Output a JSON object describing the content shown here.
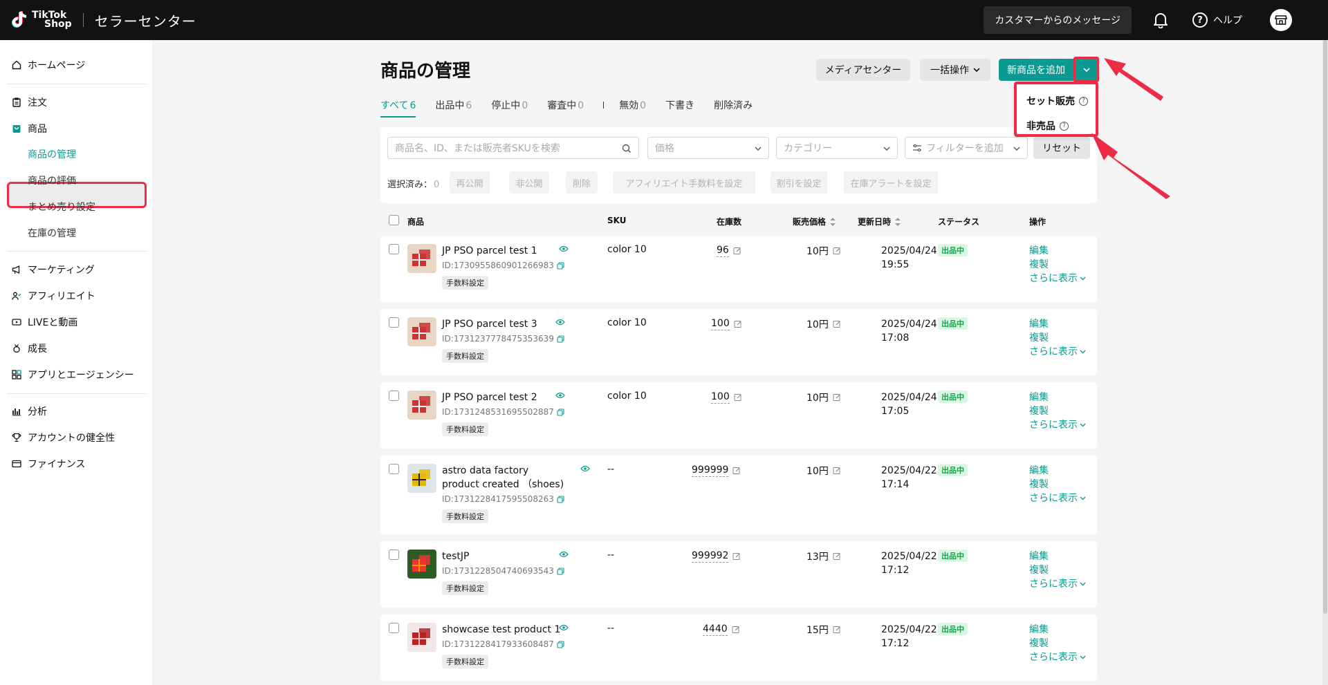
{
  "app": {
    "logo_text_1": "TikTok",
    "logo_text_2": "Shop",
    "title": "セラーセンター",
    "customer_messages": "カスタマーからのメッセージ",
    "help": "ヘルプ"
  },
  "sidebar": {
    "home": "ホームページ",
    "orders": "注文",
    "products": "商品",
    "products_sub": [
      "商品の管理",
      "商品の評価",
      "まとめ売り設定",
      "在庫の管理"
    ],
    "marketing": "マーケティング",
    "affiliate": "アフィリエイト",
    "live": "LIVEと動画",
    "growth": "成長",
    "apps": "アプリとエージェンシー",
    "analytics": "分析",
    "account_health": "アカウントの健全性",
    "finance": "ファイナンス"
  },
  "header": {
    "title": "商品の管理",
    "media_center": "メディアセンター",
    "bulk_ops": "一括操作",
    "add_product": "新商品を追加"
  },
  "add_menu": {
    "items": [
      "セット販売",
      "非売品"
    ]
  },
  "tabs": [
    {
      "label": "すべて",
      "count": "6"
    },
    {
      "label": "出品中",
      "count": "6"
    },
    {
      "label": "停止中",
      "count": "0"
    },
    {
      "label": "審査中",
      "count": "0"
    },
    {
      "label": "無効",
      "count": "0"
    },
    {
      "label": "下書き",
      "count": ""
    },
    {
      "label": "削除済み",
      "count": ""
    }
  ],
  "filters": {
    "search_placeholder": "商品名、ID、または販売者SKUを検索",
    "price": "価格",
    "category": "カテゴリー",
    "add_filter": "フィルターを追加",
    "reset": "リセット",
    "selected_label": "選択済み：",
    "selected_count": "0",
    "bulk_actions": [
      "再公開",
      "非公開",
      "削除",
      "アフィリエイト手数料を設定",
      "割引を設定",
      "在庫アラートを設定"
    ]
  },
  "table": {
    "columns": [
      "商品",
      "SKU",
      "在庫数",
      "販売価格",
      "更新日時",
      "ステータス",
      "操作"
    ],
    "fee_tag": "手数料設定",
    "ops": {
      "edit": "編集",
      "copy": "複製",
      "more": "さらに表示"
    },
    "rows": [
      {
        "name": "JP PSO parcel test 1",
        "id": "ID:1730955860901266983",
        "sku": "color 10",
        "stock": "96",
        "price": "10円",
        "date": "2025/04/24",
        "time": "19:55",
        "status": "出品中"
      },
      {
        "name": "JP PSO parcel test 3",
        "id": "ID:1731237778475353639",
        "sku": "color 10",
        "stock": "100",
        "price": "10円",
        "date": "2025/04/24",
        "time": "17:08",
        "status": "出品中"
      },
      {
        "name": "JP PSO parcel test 2",
        "id": "ID:1731248531695502887",
        "sku": "color 10",
        "stock": "100",
        "price": "10円",
        "date": "2025/04/24",
        "time": "17:05",
        "status": "出品中"
      },
      {
        "name": "astro data factory product created （shoes)",
        "id": "ID:1731228417595508263",
        "sku": "--",
        "stock": "999999",
        "price": "10円",
        "date": "2025/04/22",
        "time": "17:14",
        "status": "出品中"
      },
      {
        "name": "testJP",
        "id": "ID:1731228504740693543",
        "sku": "--",
        "stock": "999992",
        "price": "13円",
        "date": "2025/04/22",
        "time": "17:12",
        "status": "出品中"
      },
      {
        "name": "showcase test product 1",
        "id": "ID:1731228417933608487",
        "sku": "--",
        "stock": "4440",
        "price": "15円",
        "date": "2025/04/22",
        "time": "17:12",
        "status": "出品中"
      }
    ]
  },
  "colors": {
    "accent": "#0b9a90",
    "highlight": "#ee2b47",
    "status_bg": "#dcf6e4",
    "status_text": "#1d9d4e"
  }
}
